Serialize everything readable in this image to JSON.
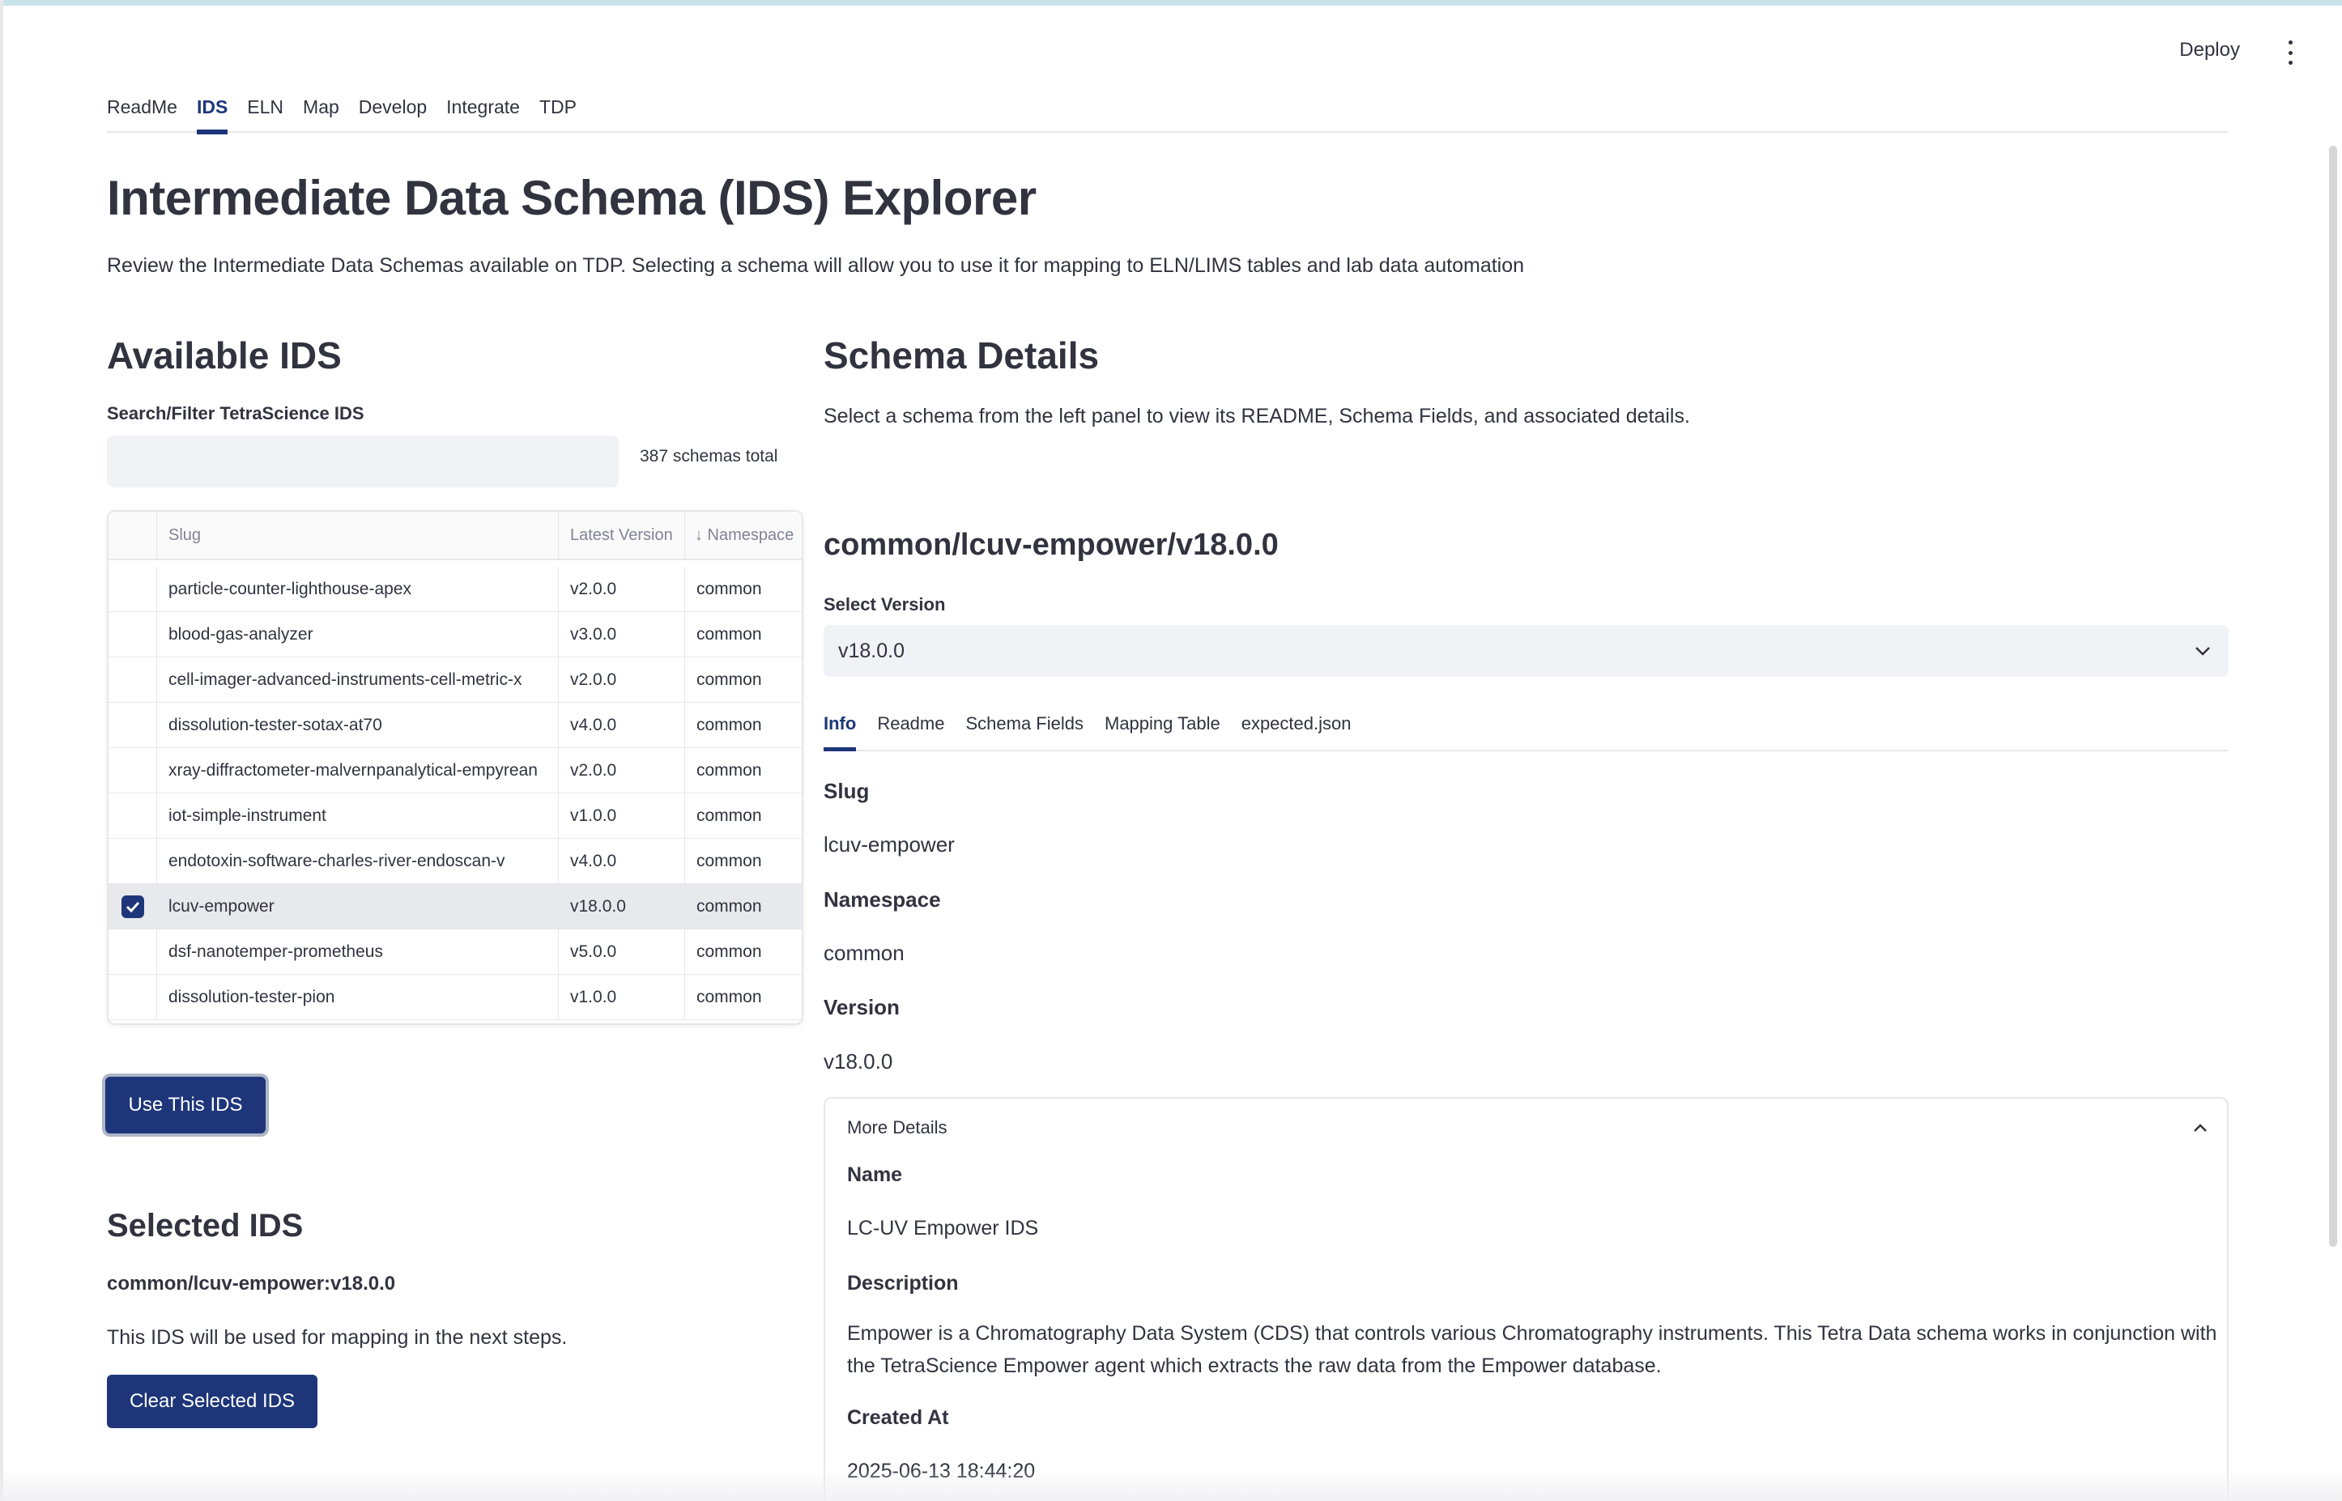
{
  "header": {
    "deploy_label": "Deploy",
    "menu_icon": "kebab-menu-icon"
  },
  "nav": {
    "tabs": [
      {
        "label": "ReadMe"
      },
      {
        "label": "IDS"
      },
      {
        "label": "ELN"
      },
      {
        "label": "Map"
      },
      {
        "label": "Develop"
      },
      {
        "label": "Integrate"
      },
      {
        "label": "TDP"
      }
    ],
    "active": "IDS"
  },
  "page": {
    "title": "Intermediate Data Schema (IDS) Explorer",
    "subtitle": "Review the Intermediate Data Schemas available on TDP. Selecting a schema will allow you to use it for mapping to ELN/LIMS tables and lab data automation"
  },
  "available": {
    "heading": "Available IDS",
    "search_label": "Search/Filter TetraScience IDS",
    "search_value": "",
    "search_placeholder": "",
    "count_text": "387 schemas total",
    "columns": [
      "",
      "Slug",
      "Latest Version",
      "↓ Namespace"
    ],
    "rows": [
      {
        "slug": "particle-counter-lighthouse-apex",
        "version": "v2.0.0",
        "namespace": "common",
        "selected": false
      },
      {
        "slug": "blood-gas-analyzer",
        "version": "v3.0.0",
        "namespace": "common",
        "selected": false
      },
      {
        "slug": "cell-imager-advanced-instruments-cell-metric-x",
        "version": "v2.0.0",
        "namespace": "common",
        "selected": false
      },
      {
        "slug": "dissolution-tester-sotax-at70",
        "version": "v4.0.0",
        "namespace": "common",
        "selected": false
      },
      {
        "slug": "xray-diffractometer-malvernpanalytical-empyrean",
        "version": "v2.0.0",
        "namespace": "common",
        "selected": false
      },
      {
        "slug": "iot-simple-instrument",
        "version": "v1.0.0",
        "namespace": "common",
        "selected": false
      },
      {
        "slug": "endotoxin-software-charles-river-endoscan-v",
        "version": "v4.0.0",
        "namespace": "common",
        "selected": false
      },
      {
        "slug": "lcuv-empower",
        "version": "v18.0.0",
        "namespace": "common",
        "selected": true
      },
      {
        "slug": "dsf-nanotemper-prometheus",
        "version": "v5.0.0",
        "namespace": "common",
        "selected": false
      },
      {
        "slug": "dissolution-tester-pion",
        "version": "v1.0.0",
        "namespace": "common",
        "selected": false
      }
    ],
    "use_button": "Use This IDS"
  },
  "selected": {
    "heading": "Selected IDS",
    "name": "common/lcuv-empower:v18.0.0",
    "note": "This IDS will be used for mapping in the next steps.",
    "clear_button": "Clear Selected IDS"
  },
  "schema": {
    "heading": "Schema Details",
    "description": "Select a schema from the left panel to view its README, Schema Fields, and associated details.",
    "title": "common/lcuv-empower/v18.0.0",
    "version_label": "Select Version",
    "version_value": "v18.0.0",
    "tabs": [
      {
        "label": "Info"
      },
      {
        "label": "Readme"
      },
      {
        "label": "Schema Fields"
      },
      {
        "label": "Mapping Table"
      },
      {
        "label": "expected.json"
      }
    ],
    "active_tab": "Info",
    "info": {
      "slug_label": "Slug",
      "slug_value": "lcuv-empower",
      "namespace_label": "Namespace",
      "namespace_value": "common",
      "version_label": "Version",
      "version_value": "v18.0.0"
    },
    "more_details": {
      "label": "More Details",
      "name_label": "Name",
      "name_value": "LC-UV Empower IDS",
      "description_label": "Description",
      "description_value": "Empower is a Chromatography Data System (CDS) that controls various Chromatography instruments. This Tetra Data schema works in conjunction with the TetraScience Empower agent which extracts the raw data from the Empower database.",
      "created_label": "Created At",
      "created_value": "2025-06-13 18:44:20"
    }
  },
  "colors": {
    "primary": "#1e3679",
    "input_bg": "#f0f2f6",
    "text": "#31333f",
    "top_bar": "#c7e5e9"
  }
}
